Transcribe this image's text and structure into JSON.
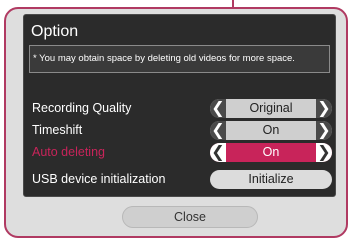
{
  "dialog": {
    "title": "Option",
    "notice": "* You may obtain space by deleting old videos for more space.",
    "rows": [
      {
        "label": "Recording Quality",
        "value": "Original"
      },
      {
        "label": "Timeshift",
        "value": "On"
      },
      {
        "label": "Auto deleting",
        "value": "On"
      }
    ],
    "usb": {
      "label": "USB device initialization",
      "button": "Initialize"
    },
    "close": "Close"
  },
  "icons": {
    "left": "chevron-left-icon",
    "right": "chevron-right-icon"
  },
  "colors": {
    "accent": "#c8245a",
    "frame": "#b03a62"
  }
}
